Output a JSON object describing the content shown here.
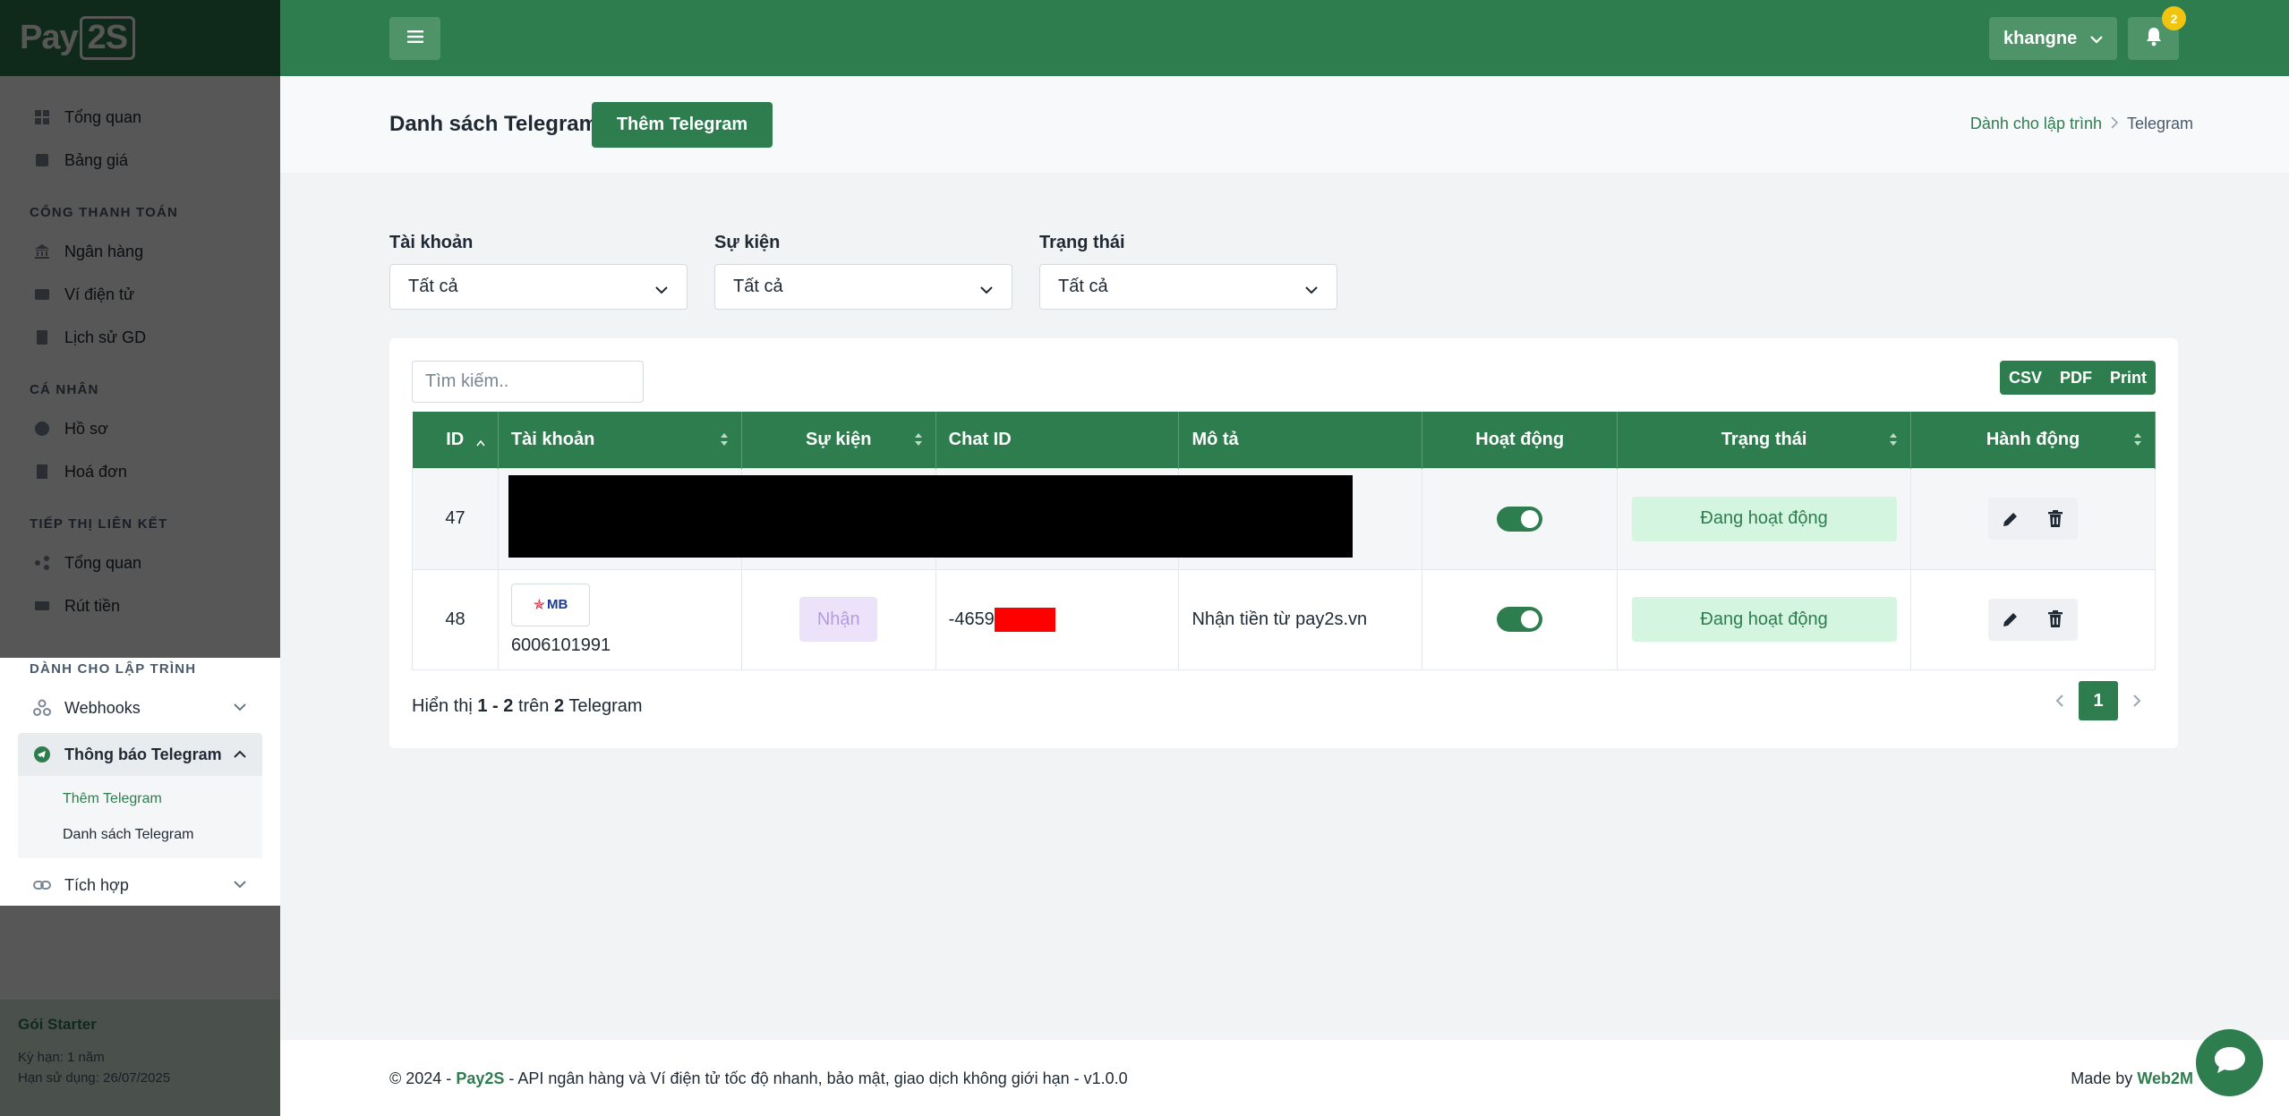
{
  "sidebar": {
    "logo": {
      "main": "Pay",
      "box": "2S"
    },
    "items_overview": [
      {
        "label": "Tổng quan",
        "icon": "grid-icon"
      },
      {
        "label": "Bảng giá",
        "icon": "price-tag-icon"
      }
    ],
    "sections": {
      "payment": "CỔNG THANH TOÁN",
      "personal": "CÁ NHÂN",
      "affiliate": "TIẾP THỊ LIÊN KẾT",
      "developer": "DÀNH CHO LẬP TRÌNH"
    },
    "payment_items": [
      "Ngân hàng",
      "Ví điện tử",
      "Lịch sử GD"
    ],
    "personal_items": [
      "Hồ sơ",
      "Hoá đơn"
    ],
    "affiliate_items": [
      "Tổng quan",
      "Rút tiền"
    ],
    "dev_items": {
      "webhooks": "Webhooks",
      "telegram": "Thông báo Telegram",
      "telegram_sub": [
        "Thêm Telegram",
        "Danh sách Telegram"
      ],
      "integration": "Tích hợp"
    },
    "plan": {
      "title": "Gói Starter",
      "term": "Kỳ hạn: 1 năm",
      "expiry": "Hạn sử dụng: 26/07/2025"
    }
  },
  "topbar": {
    "user": "khangne",
    "notifications": "2"
  },
  "page": {
    "title": "Danh sách Telegram",
    "add_button": "Thêm Telegram",
    "breadcrumb": {
      "parent": "Dành cho lập trình",
      "current": "Telegram"
    }
  },
  "filters": [
    {
      "label": "Tài khoản",
      "value": "Tất cả"
    },
    {
      "label": "Sự kiện",
      "value": "Tất cả"
    },
    {
      "label": "Trạng thái",
      "value": "Tất cả"
    }
  ],
  "search": {
    "placeholder": "Tìm kiếm.."
  },
  "exports": [
    "CSV",
    "PDF",
    "Print"
  ],
  "table": {
    "headers": [
      "ID",
      "Tài khoản",
      "Sự kiện",
      "Chat ID",
      "Mô tả",
      "Hoạt động",
      "Trạng thái",
      "Hành động"
    ],
    "rows": [
      {
        "id": "47",
        "account": "",
        "event": "",
        "chat_id": "",
        "description": "",
        "status": "Đang hoạt động"
      },
      {
        "id": "48",
        "bank": "MB",
        "account": "6006101991",
        "event": "Nhận",
        "chat_id": "-4659",
        "description": "Nhận tiền từ pay2s.vn",
        "status": "Đang hoạt động"
      }
    ]
  },
  "pagination": {
    "prefix": "Hiển thị",
    "range": "1 - 2",
    "of": "trên",
    "total": "2",
    "suffix": "Telegram",
    "current_page": "1"
  },
  "footer": {
    "copyright": "© 2024 - ",
    "brand": "Pay2S",
    "tagline": " - API ngân hàng và Ví điện tử tốc độ nhanh, bảo mật, giao dịch không giới hạn - v1.0.0",
    "made_by": "Made by ",
    "maker": "Web2M"
  },
  "colors": {
    "primary": "#2e7d4f",
    "status_bg": "#d4f5df",
    "event_bg": "#ece3fa"
  }
}
